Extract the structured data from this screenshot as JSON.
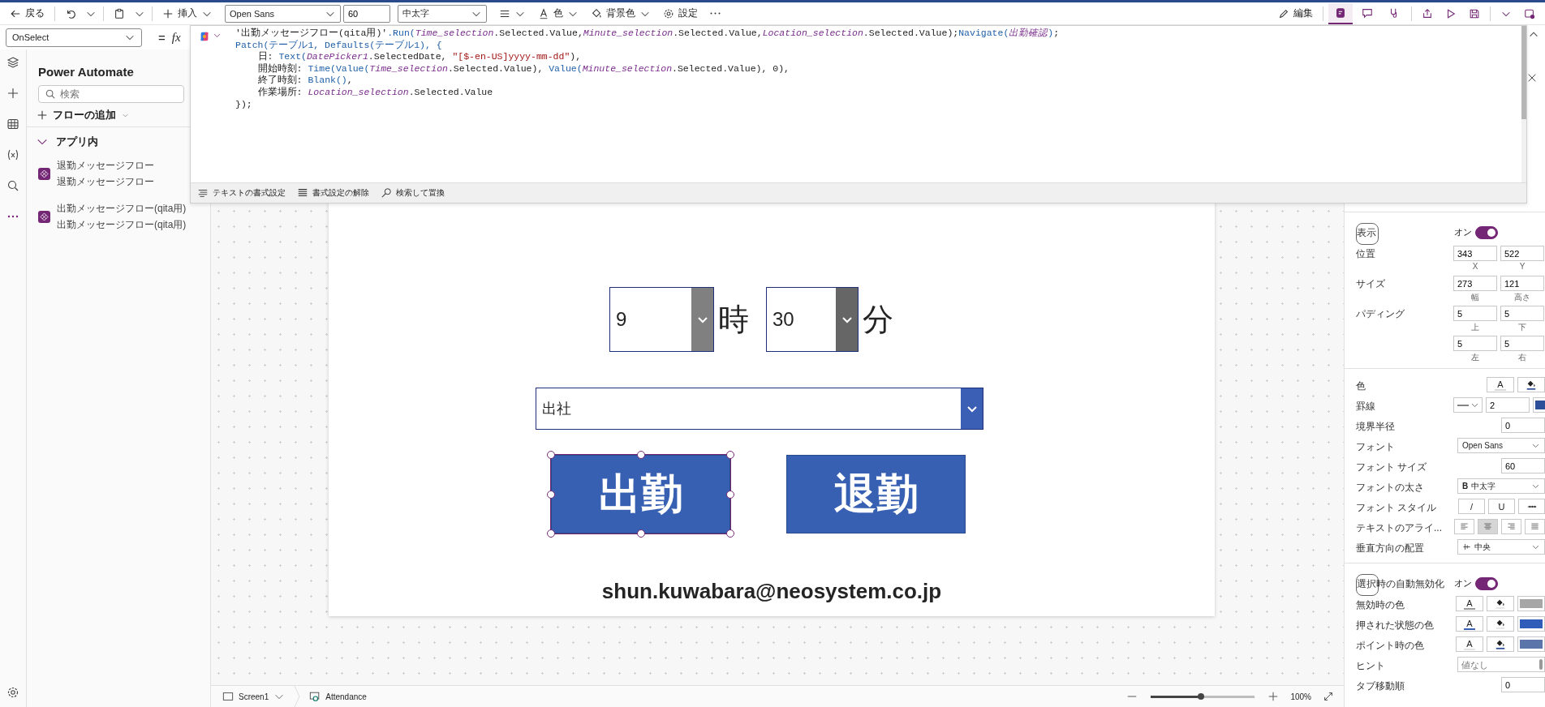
{
  "toolbar": {
    "back": "戻る",
    "insert": "挿入",
    "font": "Open Sans",
    "font_size": "60",
    "weight": "中太字",
    "color_label": "色",
    "background": "背景色",
    "settings": "設定",
    "edit": "編集",
    "code_pane": {
      "selected": true
    }
  },
  "formula": {
    "property": "OnSelect",
    "equals": "=",
    "fx": "fx",
    "code": [
      [
        {
          "kind": "plain",
          "text": "'出勤メッセージフロー(qita用)'"
        },
        {
          "kind": "func",
          "text": ".Run("
        },
        {
          "kind": "name",
          "text": "Time_selection"
        },
        {
          "kind": "plain",
          "text": ".Selected.Value,"
        },
        {
          "kind": "name",
          "text": "Minute_selection"
        },
        {
          "kind": "plain",
          "text": ".Selected.Value,"
        },
        {
          "kind": "name",
          "text": "Location_selection"
        },
        {
          "kind": "plain",
          "text": ".Selected.Value);"
        },
        {
          "kind": "func",
          "text": "Navigate("
        },
        {
          "kind": "name",
          "text": "出勤確認"
        },
        {
          "kind": "func",
          "text": ")"
        },
        {
          "kind": "plain",
          "text": ";"
        }
      ],
      [
        {
          "kind": "func",
          "text": "Patch(テーブル1, Defaults(テーブル1), {"
        }
      ],
      [
        {
          "kind": "plain",
          "text": "    日: "
        },
        {
          "kind": "func",
          "text": "Text("
        },
        {
          "kind": "name",
          "text": "DatePicker1"
        },
        {
          "kind": "plain",
          "text": ".SelectedDate, "
        },
        {
          "kind": "string",
          "text": "\"[$-en-US]yyyy-mm-dd\""
        },
        {
          "kind": "plain",
          "text": "),"
        }
      ],
      [
        {
          "kind": "plain",
          "text": "    開始時刻: "
        },
        {
          "kind": "func",
          "text": "Time(Value("
        },
        {
          "kind": "name",
          "text": "Time_selection"
        },
        {
          "kind": "plain",
          "text": ".Selected.Value), "
        },
        {
          "kind": "func",
          "text": "Value("
        },
        {
          "kind": "name",
          "text": "Minute_selection"
        },
        {
          "kind": "plain",
          "text": ".Selected.Value), 0),"
        }
      ],
      [
        {
          "kind": "plain",
          "text": "    終了時刻: "
        },
        {
          "kind": "func",
          "text": "Blank()"
        },
        {
          "kind": "plain",
          "text": ","
        }
      ],
      [
        {
          "kind": "plain",
          "text": "    作業場所: "
        },
        {
          "kind": "name",
          "text": "Location_selection"
        },
        {
          "kind": "plain",
          "text": ".Selected.Value"
        }
      ],
      [
        {
          "kind": "plain",
          "text": "});"
        }
      ]
    ],
    "format_bar": [
      "テキストの書式設定",
      "書式設定の解除",
      "検索して置換"
    ]
  },
  "left_panel": {
    "title": "Power Automate",
    "search_placeholder": "検索",
    "add_flow": "フローの追加",
    "section": {
      "label": "アプリ内",
      "expanded": true,
      "flows": [
        {
          "name": "退勤メッセージフロー",
          "subtitle": "退勤メッセージフロー"
        },
        {
          "name": "出勤メッセージフロー(qita用)",
          "subtitle": "出勤メッセージフロー(qita用)"
        }
      ]
    }
  },
  "app_screen": {
    "hour": {
      "value": "9",
      "unit": "時",
      "color": "#808080"
    },
    "minute": {
      "value": "30",
      "unit": "分",
      "color": "#666666"
    },
    "location": {
      "value": "出社",
      "color": "#3a5fb5"
    },
    "buttons": [
      {
        "label": "出勤",
        "selected": true
      },
      {
        "label": "退勤",
        "selected": false
      }
    ],
    "email": "shun.kuwabara@neosystem.co.jp"
  },
  "bottom_bar": {
    "screen": "Screen1",
    "component": "Attendance",
    "zoom": {
      "level": 0.48,
      "reading": "100%"
    }
  },
  "properties": {
    "sections": [
      {
        "rows": [
          {
            "label": "表示",
            "kind": "toggle",
            "value": "オン",
            "on": true
          },
          {
            "label": "位置",
            "kind": "pair",
            "fields": [
              {
                "value": "343",
                "caption": "X"
              },
              {
                "value": "522",
                "caption": "Y"
              }
            ]
          },
          {
            "label": "サイズ",
            "kind": "pair",
            "fields": [
              {
                "value": "273",
                "caption": "幅"
              },
              {
                "value": "121",
                "caption": "高さ"
              }
            ]
          },
          {
            "label": "パディング",
            "kind": "pair",
            "fields": [
              {
                "value": "5",
                "caption": "上"
              },
              {
                "value": "5",
                "caption": "下"
              }
            ]
          },
          {
            "kind": "pair",
            "fields": [
              {
                "value": "5",
                "caption": "左"
              },
              {
                "value": "5",
                "caption": "右"
              }
            ]
          }
        ]
      },
      {
        "rows": [
          {
            "label": "色",
            "kind": "colors",
            "items": [
              {
                "kind": "letter",
                "text": "A",
                "color": "#d9d9d9"
              },
              {
                "kind": "fill",
                "color": "#2d4f9a"
              }
            ]
          },
          {
            "label": "罫線",
            "kind": "border",
            "value": "2",
            "color": "#2d4f9a"
          },
          {
            "label": "境界半径",
            "kind": "number",
            "value": "0"
          },
          {
            "label": "フォント",
            "kind": "select",
            "value": "Open Sans"
          },
          {
            "label": "フォント サイズ",
            "kind": "number",
            "value": "60"
          },
          {
            "label": "フォントの太さ",
            "kind": "select",
            "prefix": "B",
            "value": "中太字"
          },
          {
            "label": "フォント スタイル",
            "kind": "styles",
            "items": [
              {
                "kind": "glyph",
                "text": "/"
              },
              {
                "kind": "glyph",
                "text": "U"
              },
              {
                "kind": "strike"
              }
            ]
          },
          {
            "label": "テキストのアライ...",
            "kind": "align",
            "items": [
              {
                "selected": false
              },
              {
                "selected": true
              },
              {
                "selected": false
              },
              {
                "selected": false
              }
            ]
          },
          {
            "label": "垂直方向の配置",
            "kind": "valign",
            "value": "中央"
          }
        ]
      },
      {
        "rows": [
          {
            "label": "選択時の自動無効化",
            "kind": "toggle",
            "value": "オン",
            "on": true
          },
          {
            "label": "無効時の色",
            "kind": "colors",
            "items": [
              {
                "kind": "letter",
                "text": "A",
                "color": "#9a9a9a"
              },
              {
                "kind": "fill",
                "color": "#e3e3e3"
              },
              {
                "kind": "swatch",
                "color": "#a6a6a6"
              }
            ]
          },
          {
            "label": "押された状態の色",
            "kind": "colors",
            "items": [
              {
                "kind": "letter",
                "text": "A",
                "color": "#3a5fb5"
              },
              {
                "kind": "fill",
                "color": "#e3e3e3"
              },
              {
                "kind": "swatch",
                "color": "#2e5cb8"
              }
            ]
          },
          {
            "label": "ポイント時の色",
            "kind": "colors",
            "items": [
              {
                "kind": "letter",
                "text": "A",
                "color": "#e3e3e3"
              },
              {
                "kind": "fill",
                "color": "#2d4f9a"
              },
              {
                "kind": "swatch",
                "color": "#5b75aa"
              }
            ]
          },
          {
            "label": "ヒント",
            "kind": "text",
            "placeholder": "値なし"
          },
          {
            "label": "タブ移動順",
            "kind": "number",
            "value": "0"
          }
        ]
      }
    ]
  }
}
